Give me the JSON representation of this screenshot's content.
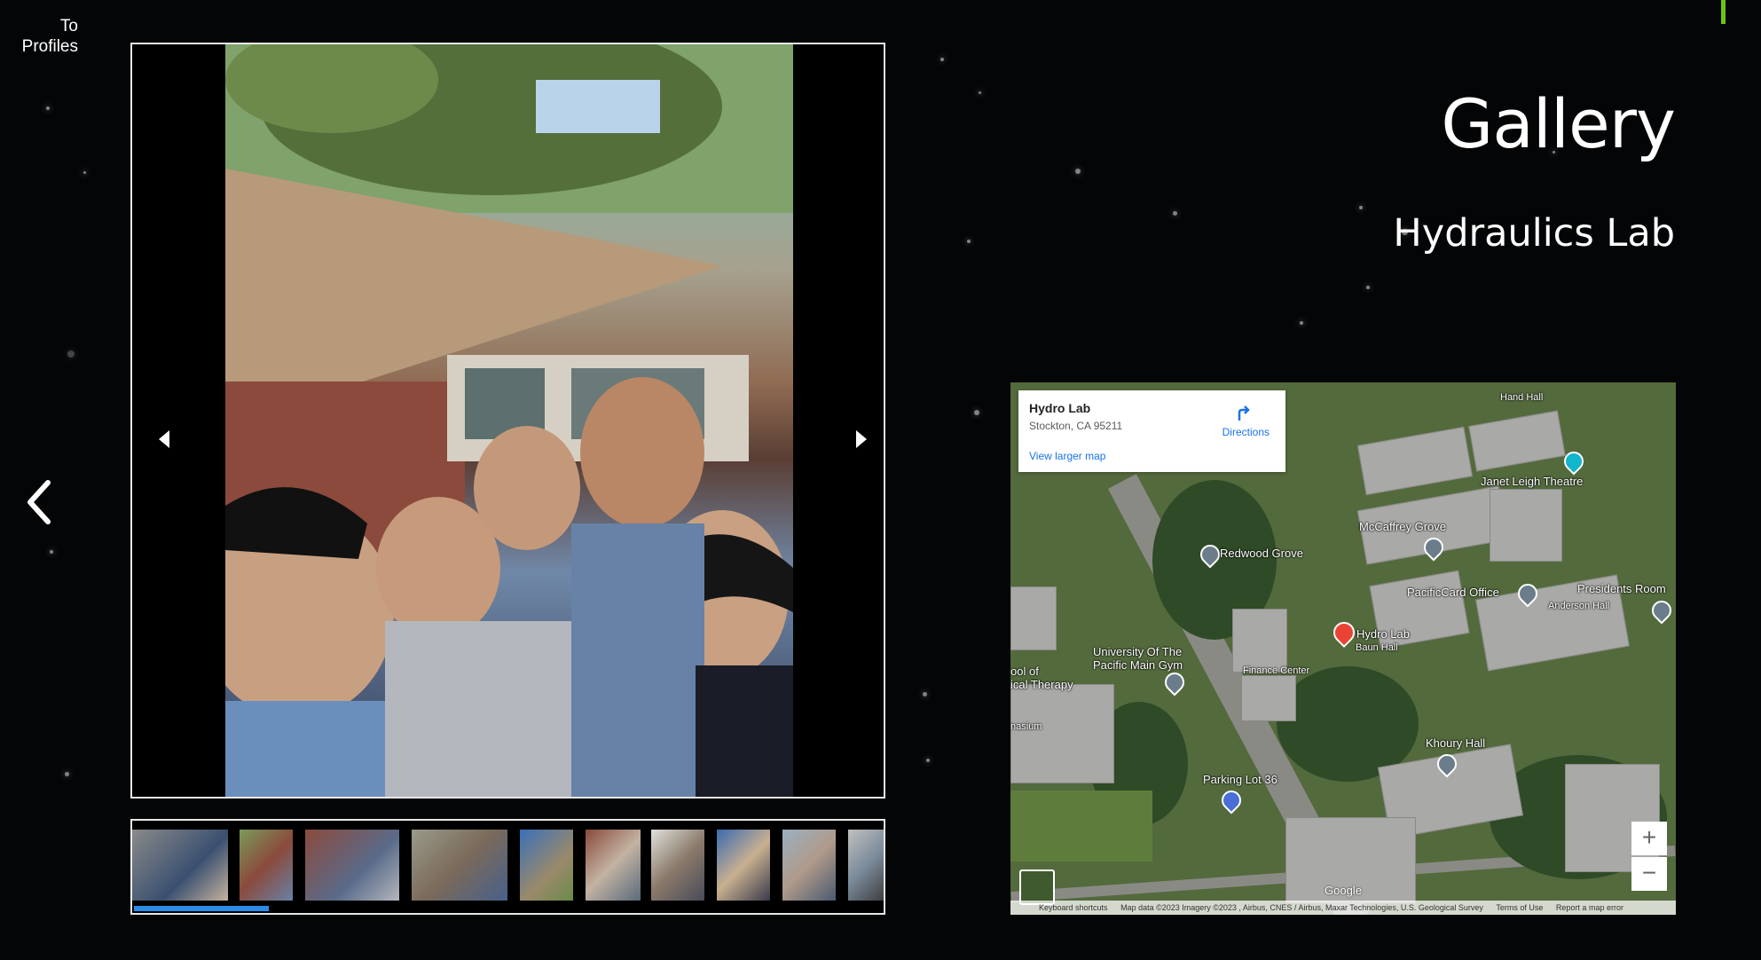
{
  "nav": {
    "back_link": "To Profiles"
  },
  "header": {
    "title": "Gallery",
    "subtitle": "Hydraulics Lab"
  },
  "gallery": {
    "thumbnail_count": 11,
    "progress": 0.18
  },
  "map": {
    "place_name": "Hydro Lab",
    "address": "Stockton, CA 95211",
    "directions_label": "Directions",
    "view_larger": "View larger map",
    "labels": {
      "hand_hall": "Hand Hall",
      "janet_leigh": "Janet Leigh Theatre",
      "mccaffrey": "McCaffrey Grove",
      "redwood": "Redwood Grove",
      "pacificcard": "PacificCard Office",
      "presidents": "Presidents Room",
      "anderson": "Anderson Hall",
      "hydro": "Hydro Lab",
      "baun": "Baun Hall",
      "gym_1": "University Of The",
      "gym_2": "Pacific Main Gym",
      "finance": "Finance Center",
      "physical_1": "ool of",
      "physical_2": "ical Therapy",
      "nasium": "nasium",
      "khoury": "Khoury Hall",
      "parking": "Parking Lot 36"
    },
    "zoom_in": "+",
    "zoom_out": "−",
    "logo": "Google",
    "footer": {
      "shortcuts": "Keyboard shortcuts",
      "attribution": "Map data ©2023 Imagery ©2023 , Airbus, CNES / Airbus, Maxar Technologies, U.S. Geological Survey",
      "terms": "Terms of Use",
      "report": "Report a map error"
    }
  },
  "colors": {
    "accent": "#6cc31a",
    "progress": "#2b8be6",
    "link": "#1a73e8",
    "marker": "#ea4335"
  }
}
